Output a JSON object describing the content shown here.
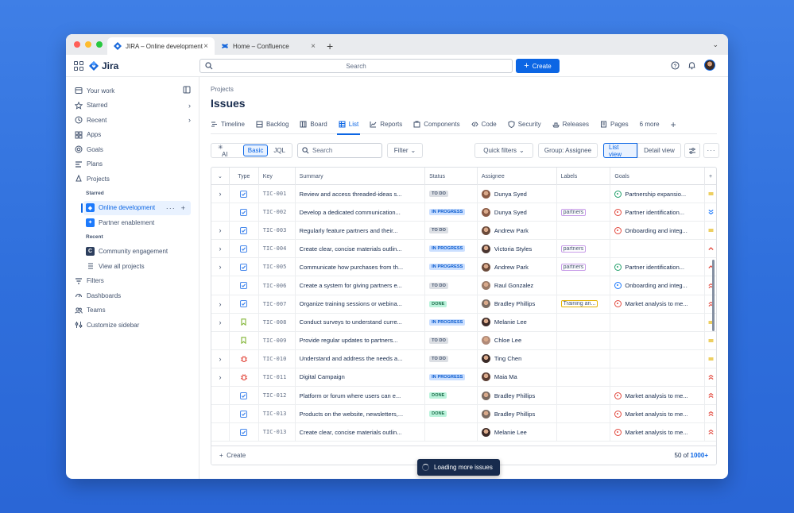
{
  "browser": {
    "tabs": [
      {
        "label": "JIRA – Online development",
        "active": true
      },
      {
        "label": "Home – Confluence",
        "active": false
      }
    ]
  },
  "topnav": {
    "app_name": "Jira",
    "search_placeholder": "Search",
    "create_label": "Create"
  },
  "sidebar": {
    "your_work": "Your work",
    "starred": "Starred",
    "recent": "Recent",
    "apps": "Apps",
    "goals": "Goals",
    "plans": "Plans",
    "projects": "Projects",
    "starred_heading": "Starred",
    "starred_projects": [
      "Online development",
      "Partner enablement"
    ],
    "recent_heading": "Recent",
    "recent_projects": [
      "Community engagement"
    ],
    "view_all": "View all projects",
    "filters": "Filters",
    "dashboards": "Dashboards",
    "teams": "Teams",
    "customize": "Customize sidebar"
  },
  "main": {
    "breadcrumb": "Projects",
    "title": "Issues",
    "tabs": [
      "Timeline",
      "Backlog",
      "Board",
      "List",
      "Reports",
      "Components",
      "Code",
      "Security",
      "Releases",
      "Pages"
    ],
    "more_tabs": "6 more",
    "active_tab": "List"
  },
  "toolbar": {
    "ai": "AI",
    "basic": "Basic",
    "jql": "JQL",
    "search_placeholder": "Search",
    "filter": "Filter",
    "quick_filters": "Quick filters",
    "group": "Group: Assignee",
    "list_view": "List view",
    "detail_view": "Detail view"
  },
  "table": {
    "headers": {
      "type": "Type",
      "key": "Key",
      "summary": "Summary",
      "status": "Status",
      "assignee": "Assignee",
      "labels": "Labels",
      "goals": "Goals"
    },
    "rows": [
      {
        "expand": true,
        "type": "task",
        "key": "TIC-001",
        "summary": "Review and access threaded-ideas s...",
        "status": "TO DO",
        "assignee": "Dunya Syed",
        "avatar": "#8a5a44",
        "label": "",
        "goal": "Partnership expansio...",
        "goal_color": "green",
        "prio": "medium"
      },
      {
        "expand": false,
        "type": "task",
        "key": "TIC-002",
        "summary": "Develop a dedicated communication...",
        "status": "IN PROGRESS",
        "assignee": "Dunya Syed",
        "avatar": "#8a5a44",
        "label": "partners",
        "goal": "Partner identification...",
        "goal_color": "red",
        "prio": "lowest"
      },
      {
        "expand": true,
        "type": "task",
        "key": "TIC-003",
        "summary": "Regularly feature partners and their...",
        "status": "TO DO",
        "assignee": "Andrew Park",
        "avatar": "#6b4a3a",
        "label": "",
        "goal": "Onboarding and integ...",
        "goal_color": "red",
        "prio": "medium"
      },
      {
        "expand": true,
        "type": "task",
        "key": "TIC-004",
        "summary": "Create clear, concise materials outlin...",
        "status": "IN PROGRESS",
        "assignee": "Victoria Styles",
        "avatar": "#4a3530",
        "label": "partners",
        "goal": "",
        "goal_color": "",
        "prio": "high"
      },
      {
        "expand": true,
        "type": "task",
        "key": "TIC-005",
        "summary": "Communicate how purchases from th...",
        "status": "IN PROGRESS",
        "assignee": "Andrew Park",
        "avatar": "#6b4a3a",
        "label": "partners",
        "goal": "Partner identification...",
        "goal_color": "green",
        "prio": "high"
      },
      {
        "expand": false,
        "type": "task",
        "key": "TIC-006",
        "summary": "Create a system for giving partners e...",
        "status": "TO DO",
        "assignee": "Raul Gonzalez",
        "avatar": "#9a7a66",
        "label": "",
        "goal": "Onboarding and integ...",
        "goal_color": "blue",
        "prio": "highest"
      },
      {
        "expand": true,
        "type": "task",
        "key": "TIC-007",
        "summary": "Organize training sessions or webina...",
        "status": "DONE",
        "assignee": "Bradley Phillips",
        "avatar": "#7a6a60",
        "label": "Training an...",
        "label_yellow": true,
        "goal": "Market analysis to me...",
        "goal_color": "red",
        "prio": "highest"
      },
      {
        "expand": true,
        "type": "story",
        "key": "TIC-008",
        "summary": "Conduct surveys to understand curre...",
        "status": "IN PROGRESS",
        "assignee": "Melanie Lee",
        "avatar": "#3d2a26",
        "label": "",
        "goal": "",
        "goal_color": "",
        "prio": "medium"
      },
      {
        "expand": false,
        "type": "story",
        "key": "TIC-009",
        "summary": "Provide regular updates to partners...",
        "status": "TO DO",
        "assignee": "Chloe Lee",
        "avatar": "#b08a78",
        "label": "",
        "goal": "",
        "goal_color": "",
        "prio": "medium"
      },
      {
        "expand": true,
        "type": "bug",
        "key": "TIC-010",
        "summary": "Understand and address the needs a...",
        "status": "TO DO",
        "assignee": "Ting Chen",
        "avatar": "#3a2a26",
        "label": "",
        "goal": "",
        "goal_color": "",
        "prio": "medium"
      },
      {
        "expand": true,
        "type": "bug",
        "key": "TIC-011",
        "summary": "Digital Campaign",
        "status": "IN PROGRESS",
        "assignee": "Maia Ma",
        "avatar": "#5a3d32",
        "label": "",
        "goal": "",
        "goal_color": "",
        "prio": "highest"
      },
      {
        "expand": false,
        "type": "task",
        "key": "TIC-012",
        "summary": "Platform or forum where users can e...",
        "status": "DONE",
        "assignee": "Bradley Phillips",
        "avatar": "#7a6a60",
        "label": "",
        "goal": "Market analysis to me...",
        "goal_color": "red",
        "prio": "highest"
      },
      {
        "expand": false,
        "type": "task",
        "key": "TIC-013",
        "summary": "Products on the website, newsletters,...",
        "status": "DONE",
        "assignee": "Bradley Phillips",
        "avatar": "#7a6a60",
        "label": "",
        "goal": "Market analysis to me...",
        "goal_color": "red",
        "prio": "highest"
      },
      {
        "expand": false,
        "type": "task",
        "key": "TIC-013",
        "summary": "Create clear, concise materials outlin...",
        "status": "",
        "assignee": "Melanie Lee",
        "avatar": "#3d2a26",
        "label": "",
        "goal": "Market analysis to me...",
        "goal_color": "red",
        "prio": "highest"
      }
    ],
    "footer_create": "Create",
    "count_prefix": "50 of",
    "count_total": "1000+",
    "loading": "Loading more issues"
  },
  "colors": {
    "accent": "#0c66e4",
    "background": "#3f7fe6"
  }
}
